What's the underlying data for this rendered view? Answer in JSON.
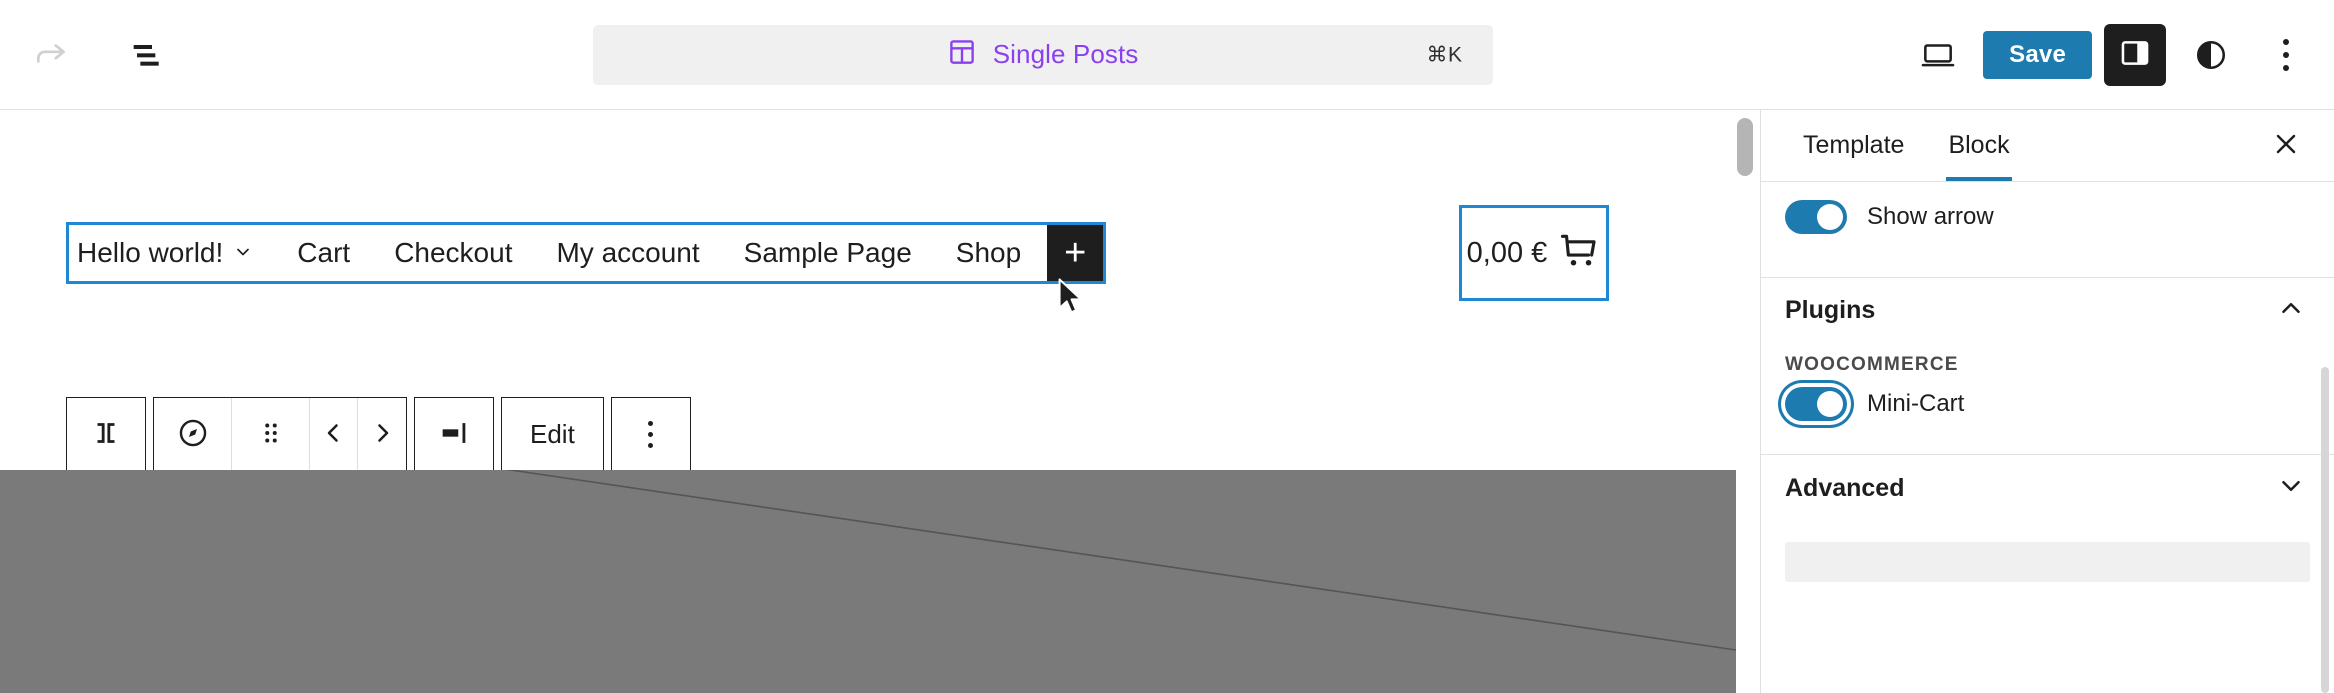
{
  "header": {
    "redo_icon": "redo-arrow-icon",
    "list_view_icon": "list-view-icon",
    "command_bar": {
      "icon": "template-icon",
      "title": "Single Posts",
      "shortcut": "⌘K"
    },
    "preview_icon": "desktop-preview-icon",
    "save_label": "Save",
    "sidebar_toggle_icon": "settings-sidebar-icon",
    "styles_icon": "contrast-styles-icon",
    "options_icon": "more-options-icon"
  },
  "canvas": {
    "navigation": {
      "items": [
        {
          "label": "Hello world!",
          "has_submenu": true
        },
        {
          "label": "Cart",
          "has_submenu": false
        },
        {
          "label": "Checkout",
          "has_submenu": false
        },
        {
          "label": "My account",
          "has_submenu": false
        },
        {
          "label": "Sample Page",
          "has_submenu": false
        },
        {
          "label": "Shop",
          "has_submenu": false
        }
      ],
      "add_label": "+"
    },
    "block_toolbar": {
      "select_parent_icon": "select-parent-block-icon",
      "block_type_icon": "navigation-block-icon",
      "drag_icon": "drag-handle-icon",
      "move_left_icon": "move-left-icon",
      "move_right_icon": "move-right-icon",
      "justify_icon": "justification-icon",
      "edit_label": "Edit",
      "options_icon": "block-more-options-icon"
    },
    "mini_cart": {
      "price": "0,00 €",
      "icon": "shopping-cart-icon"
    },
    "cursor_icon": "mouse-pointer-icon"
  },
  "sidebar": {
    "tabs": [
      {
        "label": "Template",
        "active": false
      },
      {
        "label": "Block",
        "active": true
      }
    ],
    "close_icon": "close-icon",
    "show_arrow": {
      "label": "Show arrow",
      "enabled": true
    },
    "plugins": {
      "title": "Plugins",
      "collapse_icon": "chevron-up-icon",
      "group_label": "WOOCOMMERCE",
      "items": [
        {
          "label": "Mini-Cart",
          "enabled": true
        }
      ]
    },
    "advanced": {
      "title": "Advanced",
      "expand_icon": "chevron-down-icon"
    }
  },
  "colors": {
    "accent_blue": "#1e7bb0",
    "selection_blue": "#1e88d4",
    "command_purple": "#8b40ef",
    "dark": "#1e1e1e",
    "placeholder_gray": "#7a7a7a"
  }
}
